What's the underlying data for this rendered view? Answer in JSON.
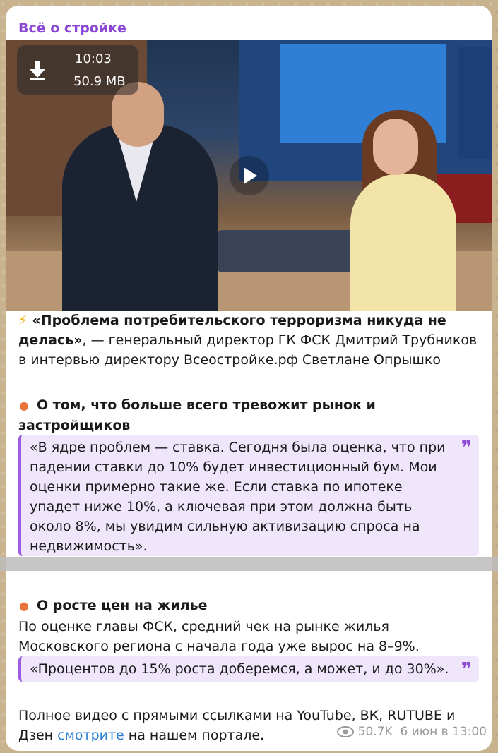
{
  "channel": {
    "name": "Всё о стройке"
  },
  "video": {
    "duration": "10:03",
    "size": "50.9 MB",
    "download_icon": "download-arrow-icon",
    "play_icon": "play-icon"
  },
  "post": {
    "headline_icon": "⚡",
    "headline_bold": "«Проблема потребительского терроризма никуда не делась»",
    "headline_rest": ", — генеральный директор ГК ФСК Дмитрий Трубников в интервью директору Всеостройке.рф Светлане Опрышко",
    "section1_title": "О том, что больше всего тревожит рынок и застройщиков",
    "quote1": "«В ядре проблем — ставка. Сегодня была оценка, что при падении ставки до 10% будет инвестиционный бум. Мои оценки примерно такие же. Если ставка по ипотеке упадет ниже 10%, а ключевая при этом должна быть около 8%, мы увидим сильную активизацию спроса на недвижимость».",
    "section2_title": "О росте цен на жилье",
    "section2_text": "По оценке главы ФСК, средний чек на рынке жилья Московского региона с начала года уже вырос на 8–9%.",
    "quote2": "«Процентов до 15% роста доберемся, а может, и до 30%».",
    "footer_pre": "Полное видео с прямыми ссылками на YouTube, ВК, RUTUBE и Дзен ",
    "footer_link": "смотрите",
    "footer_post": " на нашем портале."
  },
  "meta": {
    "views": "50.7K",
    "date": "6 июн в 13:00"
  },
  "colors": {
    "accent": "#8e48d6",
    "link": "#2b7fd4",
    "bullet": "#e8743b",
    "quote_bg": "#efe6fb"
  }
}
